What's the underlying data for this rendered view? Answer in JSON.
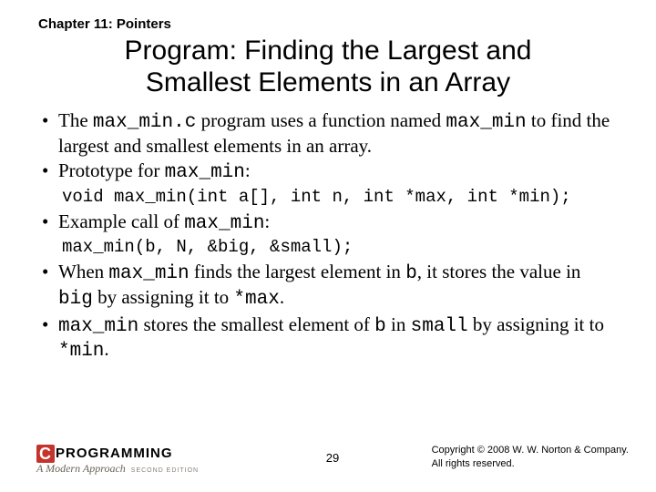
{
  "chapter": "Chapter 11: Pointers",
  "title_line1": "Program: Finding the Largest and",
  "title_line2": "Smallest Elements in an Array",
  "b1_a": "The ",
  "b1_code1": "max_min.c",
  "b1_b": " program uses a function named ",
  "b1_code2": "max_min",
  "b1_c": " to find the largest and smallest elements in an array.",
  "b2_a": "Prototype for ",
  "b2_code": "max_min",
  "b2_b": ":",
  "code1": "void max_min(int a[], int n, int *max, int *min);",
  "b3_a": "Example call of ",
  "b3_code": "max_min",
  "b3_b": ":",
  "code2": "max_min(b, N, &big, &small);",
  "b4_a": "When ",
  "b4_code1": "max_min",
  "b4_b": " finds the largest element in ",
  "b4_code2": "b",
  "b4_c": ", it stores the value in ",
  "b4_code3": "big",
  "b4_d": " by assigning it to ",
  "b4_code4": "*max",
  "b4_e": ".",
  "b5_code1": "max_min",
  "b5_a": " stores the smallest element of ",
  "b5_code2": "b",
  "b5_b": " in ",
  "b5_code3": "small",
  "b5_c": " by assigning it to ",
  "b5_code4": "*min",
  "b5_d": ".",
  "logo_c": "C",
  "logo_text": "PROGRAMMING",
  "logo_sub": "A Modern Approach",
  "logo_edition": "SECOND EDITION",
  "page": "29",
  "copy1": "Copyright © 2008 W. W. Norton & Company.",
  "copy2": "All rights reserved."
}
